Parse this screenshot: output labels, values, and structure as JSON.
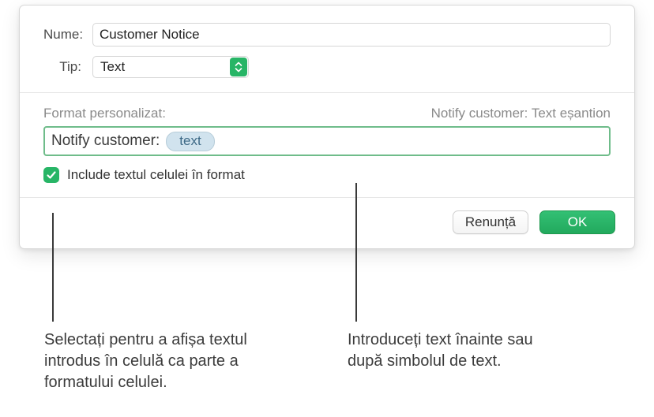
{
  "fields": {
    "name_label": "Nume:",
    "name_value": "Customer Notice",
    "type_label": "Tip:",
    "type_value": "Text"
  },
  "format": {
    "section_label": "Format personalizat:",
    "preview": "Notify customer: Text eșantion",
    "prefix_text": "Notify customer:",
    "token_label": "text"
  },
  "checkbox": {
    "label": "Include textul celulei în format",
    "checked": true
  },
  "buttons": {
    "cancel": "Renunță",
    "ok": "OK"
  },
  "callouts": {
    "left": "Selectați pentru a afișa textul introdus în celulă ca parte a formatului celulei.",
    "right": "Introduceți text înainte sau după simbolul de text."
  }
}
